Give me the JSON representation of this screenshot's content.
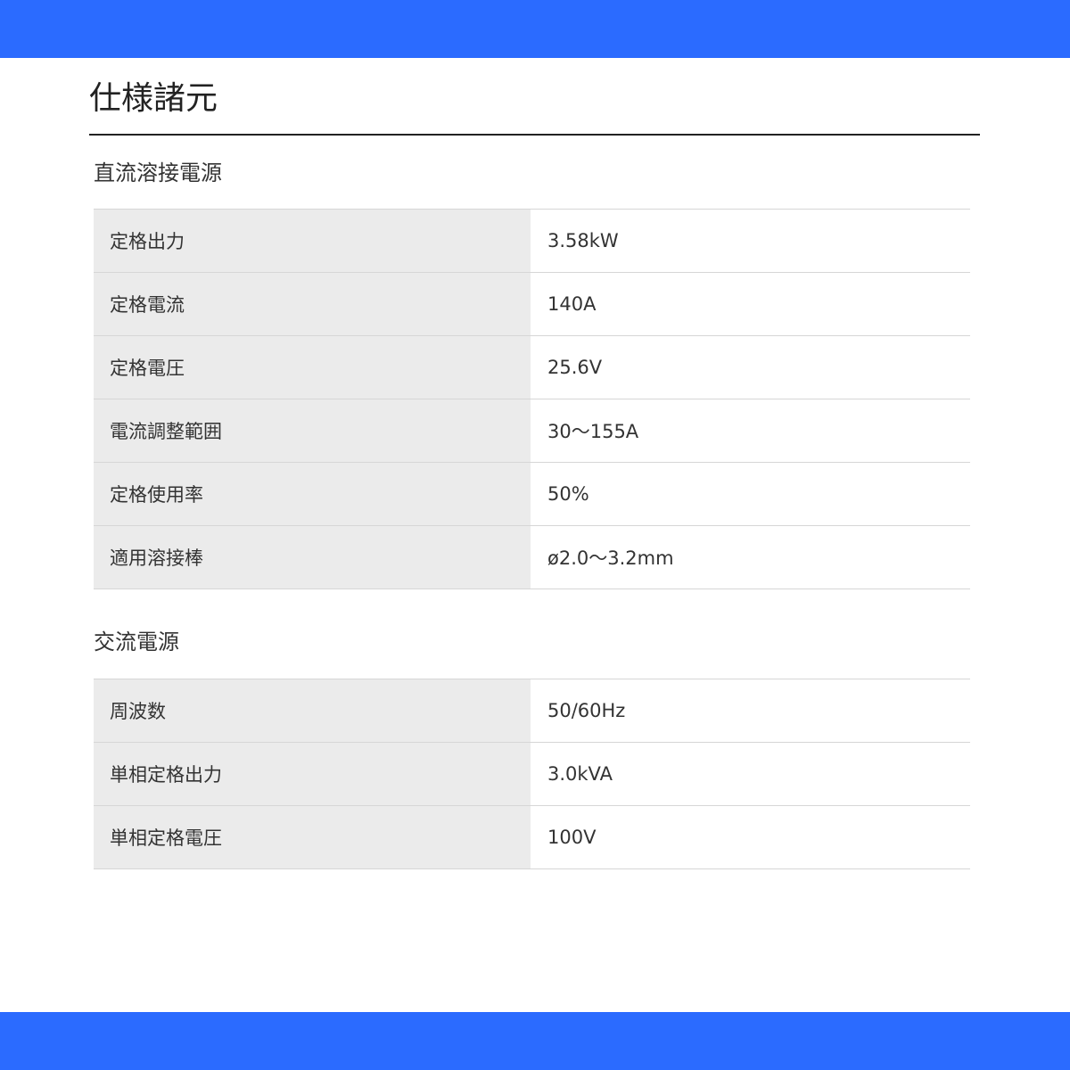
{
  "page": {
    "title": "仕様諸元",
    "colors": {
      "band": "#2b6bff",
      "label_bg": "#ebebeb",
      "rule": "#222222",
      "row_border": "#d6d6d6"
    }
  },
  "sections": [
    {
      "heading": "直流溶接電源",
      "rows": [
        {
          "label": "定格出力",
          "value": "3.58kW"
        },
        {
          "label": "定格電流",
          "value": "140A"
        },
        {
          "label": "定格電圧",
          "value": "25.6V"
        },
        {
          "label": "電流調整範囲",
          "value": "30〜155A"
        },
        {
          "label": "定格使用率",
          "value": "50%"
        },
        {
          "label": "適用溶接棒",
          "value": "ø2.0〜3.2mm"
        }
      ]
    },
    {
      "heading": "交流電源",
      "rows": [
        {
          "label": "周波数",
          "value": "50/60Hz"
        },
        {
          "label": "単相定格出力",
          "value": "3.0kVA"
        },
        {
          "label": "単相定格電圧",
          "value": "100V"
        }
      ]
    }
  ]
}
